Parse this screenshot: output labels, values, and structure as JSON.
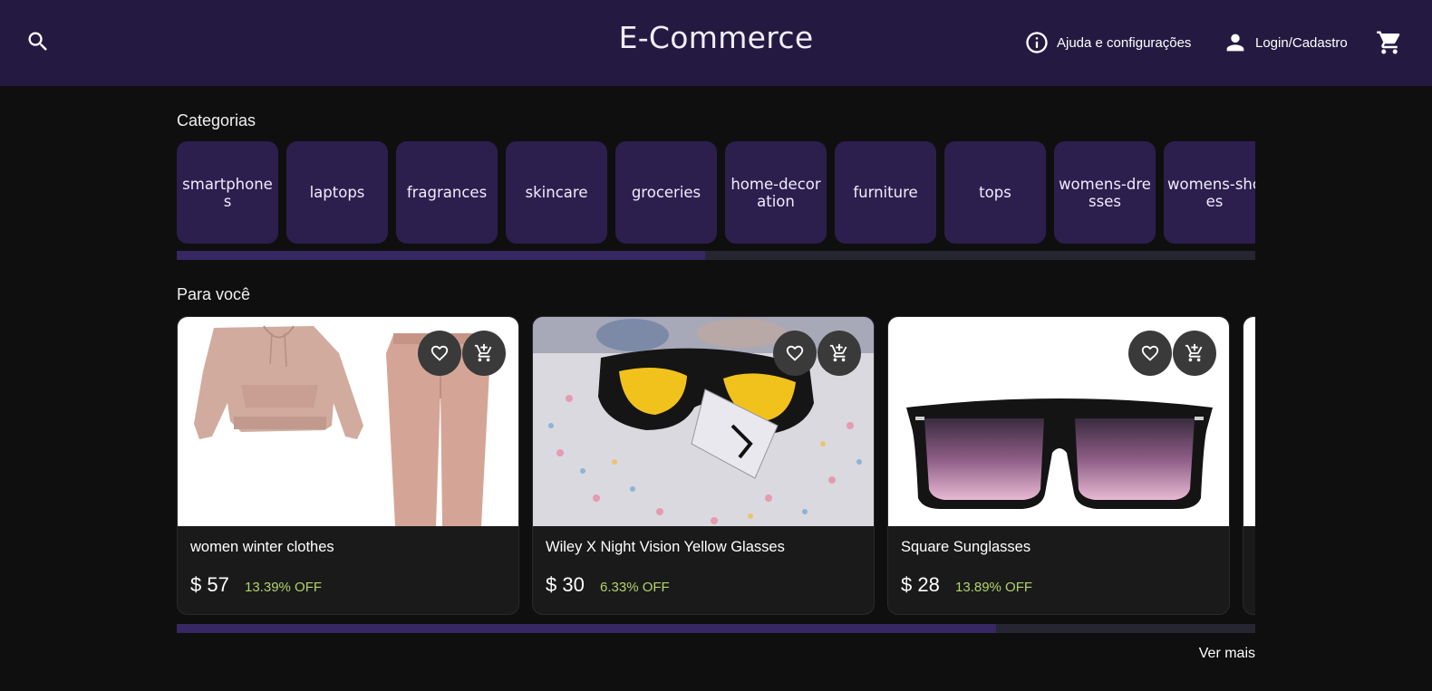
{
  "header": {
    "title": "E-Commerce",
    "help_label": "Ajuda e configurações",
    "login_label": "Login/Cadastro",
    "icons": {
      "search": "search-icon",
      "help": "info-icon",
      "login": "person-icon",
      "cart": "cart-icon"
    }
  },
  "categories": {
    "title": "Categorias",
    "items": [
      "smartphones",
      "laptops",
      "fragrances",
      "skincare",
      "groceries",
      "home-decoration",
      "furniture",
      "tops",
      "womens-dresses",
      "womens-shoes"
    ],
    "scroll_fraction": 0.49
  },
  "for_you": {
    "title": "Para você",
    "products": [
      {
        "name": "women winter clothes",
        "price": "$ 57",
        "discount": "13.39% OFF"
      },
      {
        "name": "Wiley X Night Vision Yellow Glasses",
        "price": "$ 30",
        "discount": "6.33% OFF"
      },
      {
        "name": "Square Sunglasses",
        "price": "$ 28",
        "discount": "13.89% OFF"
      }
    ],
    "scroll_fraction": 0.76,
    "see_more_label": "Ver mais"
  },
  "colors": {
    "header_bg": "#241a41",
    "tile_bg": "#2c1f4e",
    "discount": "#b4d36a",
    "page_bg": "#0f0f0f"
  }
}
